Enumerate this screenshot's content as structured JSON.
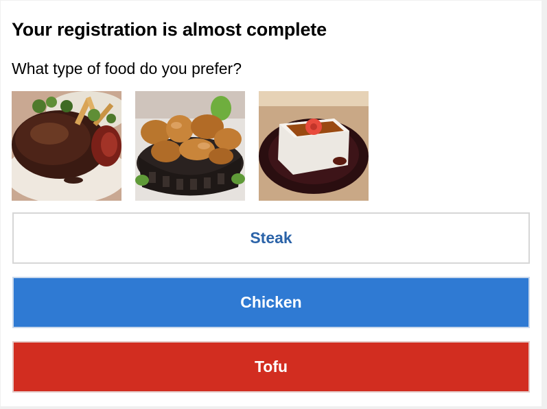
{
  "header": {
    "title": "Your registration is almost complete"
  },
  "question": {
    "text": "What type of food do you prefer?"
  },
  "images": [
    {
      "icon": "steak-photo"
    },
    {
      "icon": "fried-chicken-photo"
    },
    {
      "icon": "tofu-photo"
    }
  ],
  "choices": [
    {
      "label": "Steak",
      "color": "#ffffff",
      "text_color": "#2b63a8"
    },
    {
      "label": "Chicken",
      "color": "#2f7ad3",
      "text_color": "#ffffff"
    },
    {
      "label": "Tofu",
      "color": "#d22d20",
      "text_color": "#ffffff"
    }
  ]
}
